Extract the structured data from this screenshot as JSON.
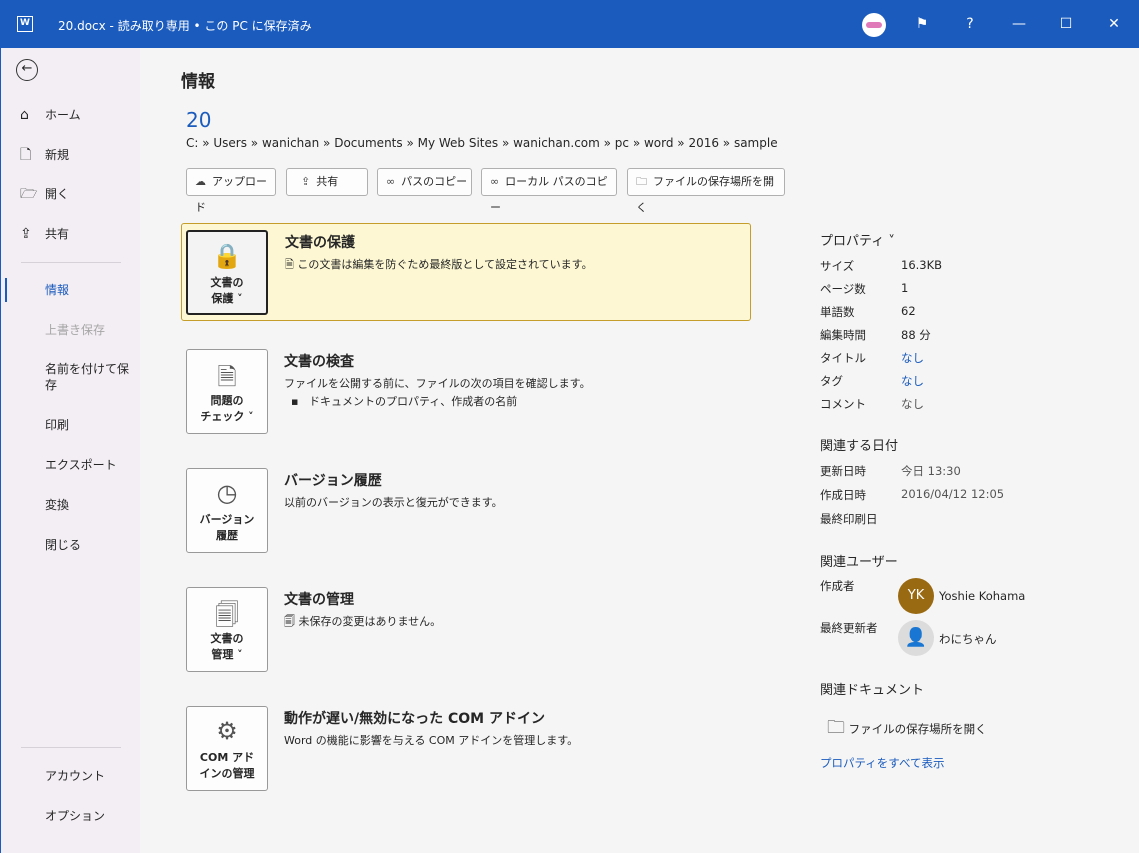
{
  "titlebar": {
    "title": "20.docx  -  読み取り専用 • この PC に保存済み",
    "app_icon": "W",
    "help": "?",
    "minimize": "—",
    "maximize": "☐",
    "close": "✕"
  },
  "sidebar": {
    "items": [
      {
        "label": "ホーム",
        "icon": "⌂"
      },
      {
        "label": "新規",
        "icon": "🗋"
      },
      {
        "label": "開く",
        "icon": "🗁"
      },
      {
        "label": "共有",
        "icon": "⇪"
      },
      {
        "label": "情報"
      },
      {
        "label": "上書き保存"
      },
      {
        "label": "名前を付けて保存"
      },
      {
        "label": "印刷"
      },
      {
        "label": "エクスポート"
      },
      {
        "label": "変換"
      },
      {
        "label": "閉じる"
      },
      {
        "label": "アカウント"
      },
      {
        "label": "オプション"
      }
    ]
  },
  "main": {
    "heading": "情報",
    "doc_name": "20",
    "path": "C: » Users » wanichan » Documents » My Web Sites » wanichan.com » pc » word » 2016 » sample",
    "actions": [
      "アップロード",
      "共有",
      "パスのコピー",
      "ローカル パスのコピー",
      "ファイルの保存場所を開く"
    ],
    "cards": [
      {
        "btn1": "文書の",
        "btn2": "保護 ˅",
        "title": "文書の保護",
        "desc": "この文書は編集を防ぐため最終版として設定されています。"
      },
      {
        "btn1": "問題の",
        "btn2": "チェック ˅",
        "title": "文書の検査",
        "desc": "ファイルを公開する前に、ファイルの次の項目を確認します。",
        "bullet": "ドキュメントのプロパティ、作成者の名前"
      },
      {
        "btn1": "バージョン",
        "btn2": "履歴",
        "title": "バージョン履歴",
        "desc": "以前のバージョンの表示と復元ができます。"
      },
      {
        "btn1": "文書の",
        "btn2": "管理 ˅",
        "title": "文書の管理",
        "desc": "未保存の変更はありません。"
      },
      {
        "btn1": "COM アド",
        "btn2": "インの管理",
        "title": "動作が遅い/無効になった COM アドイン",
        "desc": "Word の機能に影響を与える COM アドインを管理します。"
      }
    ]
  },
  "properties": {
    "heading": "プロパティ ˅",
    "rows": [
      {
        "k": "サイズ",
        "v": "16.3KB"
      },
      {
        "k": "ページ数",
        "v": "1"
      },
      {
        "k": "単語数",
        "v": "62"
      },
      {
        "k": "編集時間",
        "v": "88 分"
      },
      {
        "k": "タイトル",
        "v": "なし"
      },
      {
        "k": "タグ",
        "v": "なし"
      },
      {
        "k": "コメント",
        "v": "なし"
      }
    ],
    "dates_heading": "関連する日付",
    "dates": [
      {
        "k": "更新日時",
        "v": "今日 13:30"
      },
      {
        "k": "作成日時",
        "v": "2016/04/12 12:05"
      },
      {
        "k": "最終印刷日",
        "v": ""
      }
    ],
    "users_heading": "関連ユーザー",
    "author_label": "作成者",
    "author_initials": "YK",
    "author": "Yoshie Kohama",
    "modifier_label": "最終更新者",
    "modifier": "わにちゃん",
    "docs_heading": "関連ドキュメント",
    "open_location": "ファイルの保存場所を開く",
    "show_all": "プロパティをすべて表示"
  }
}
